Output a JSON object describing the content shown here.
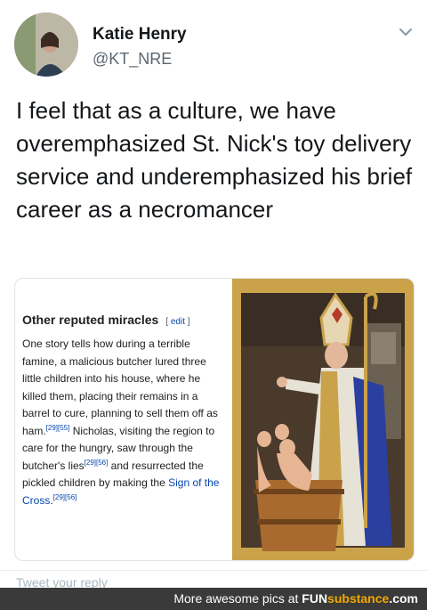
{
  "author": {
    "name": "Katie Henry",
    "handle": "@KT_NRE"
  },
  "tweet": {
    "text": "I feel that as a culture, we have overemphasized St. Nick's toy delivery service and underemphasized his brief career as a necromancer"
  },
  "wiki": {
    "heading": "Other reputed miracles",
    "edit_label": "edit",
    "paragraph_1": "One story tells how during a terrible famine, a malicious butcher lured three little children into his house, where he killed them, placing their remains in a barrel to cure, planning to sell them off as ham.",
    "ref_1": "[29][55]",
    "paragraph_2": " Nicholas, visiting the region to care for the hungry, saw through the butcher's lies",
    "ref_2": "[29][56]",
    "paragraph_3": " and resurrected the pickled children by making the ",
    "link_text": "Sign of the Cross",
    "paragraph_4": ".",
    "ref_3": "[29][56]"
  },
  "reply": {
    "placeholder": "Tweet your reply"
  },
  "watermark": {
    "prefix": "More awesome pics at ",
    "brand_a": "FUN",
    "brand_b": "substance",
    "brand_c": ".com"
  },
  "colors": {
    "text": "#14171a",
    "muted": "#5b6670",
    "wiki_link": "#0645ad",
    "watermark_bg": "#3a3a3a",
    "watermark_accent": "#f2a900"
  },
  "icons": {
    "chevron": "chevron-down-icon"
  }
}
